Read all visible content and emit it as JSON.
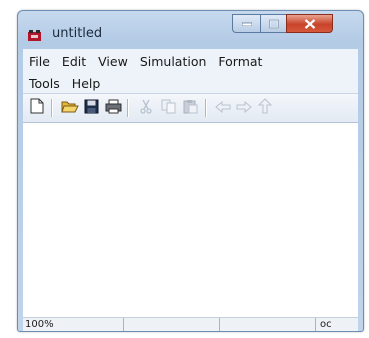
{
  "window": {
    "title": "untitled"
  },
  "menubar": {
    "row1": [
      "File",
      "Edit",
      "View",
      "Simulation",
      "Format"
    ],
    "row2": [
      "Tools",
      "Help"
    ]
  },
  "toolbar": {
    "buttons": [
      {
        "icon": "new-file-icon",
        "enabled": true
      },
      {
        "icon": "open-folder-icon",
        "enabled": true
      },
      {
        "icon": "save-icon",
        "enabled": true
      },
      {
        "icon": "print-icon",
        "enabled": true
      },
      {
        "icon": "cut-icon",
        "enabled": false
      },
      {
        "icon": "copy-icon",
        "enabled": false
      },
      {
        "icon": "paste-icon",
        "enabled": false
      },
      {
        "icon": "undo-icon",
        "enabled": false
      },
      {
        "icon": "redo-icon",
        "enabled": false
      },
      {
        "icon": "up-arrow-icon",
        "enabled": false
      }
    ]
  },
  "statusbar": {
    "zoom": "100%",
    "solver": "oc"
  }
}
